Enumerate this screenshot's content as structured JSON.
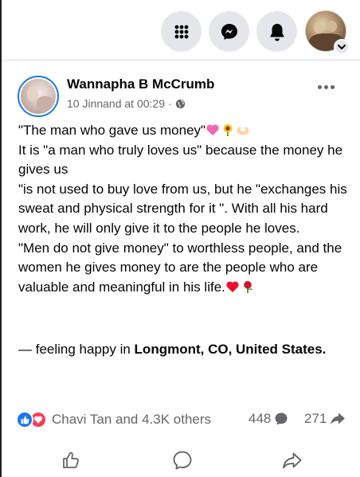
{
  "topbar": {
    "icons": [
      "menu-grid-icon",
      "messenger-icon",
      "bell-icon"
    ],
    "profile_chevron": "chevron-down-icon"
  },
  "post": {
    "author": "Wannapha B McCrumb",
    "timestamp": "10 Jinnand at 00:29",
    "meta_separator": "·",
    "privacy_icon": "globe-icon",
    "text": {
      "p1": "\"The man who gave us money\"",
      "p2": "It is \"a man who truly loves us\" because the money he gives us",
      "p3": "\"is not used to buy love from us, but he \"exchanges his sweat and physical strength for it \". With all his hard work, he will only give it to the people he loves.",
      "p4": "\"Men do not give money\" to worthless people, and the women he gives money to are the people who are valuable and meaningful in his life."
    },
    "feeling": {
      "prefix": "— feeling happy in ",
      "place": "Longmont, CO, United States",
      "suffix": "."
    },
    "reactions": {
      "text": "Chavi Tan and 4.3K others",
      "icons": [
        "like-reaction-icon",
        "love-reaction-icon"
      ]
    },
    "comments_count": "448",
    "shares_count": "271",
    "actions": [
      "like-icon",
      "comment-icon",
      "share-icon"
    ]
  },
  "colors": {
    "accent": "#1877f2",
    "love": "#f33e58",
    "secondary_text": "#65676b",
    "button_bg": "#e4e6eb"
  }
}
